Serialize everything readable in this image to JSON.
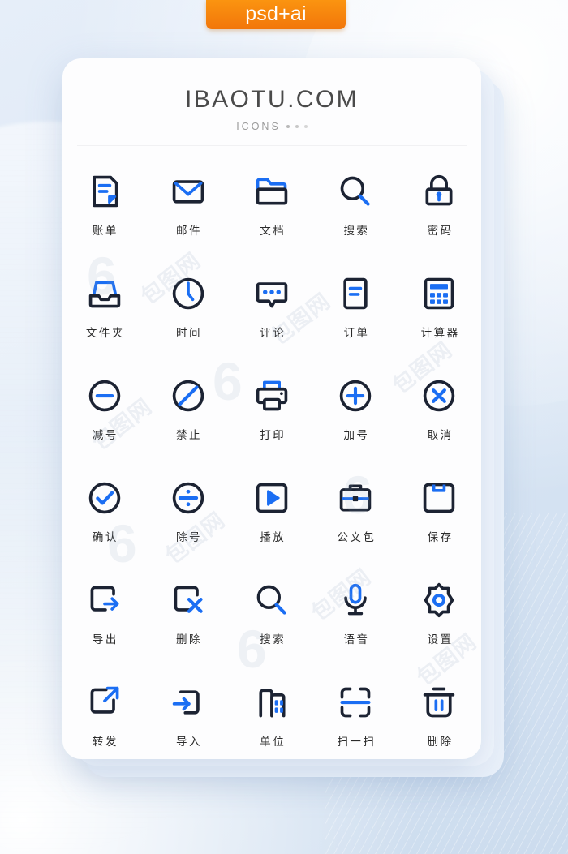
{
  "tag": {
    "label": "psd+ai",
    "color": "#f5820b"
  },
  "header": {
    "brand": "IBAOTU.COM",
    "subtitle": "ICONS"
  },
  "palette": {
    "icon_dark": "#1c2333",
    "icon_blue": "#1b6ef3",
    "background": "#dbe7f5",
    "card": "#fdfdfe",
    "caption": "#2b2b2b"
  },
  "watermark": {
    "text": "包图网",
    "mark": "6"
  },
  "grid": {
    "columns": 5,
    "rows": 6,
    "icons": [
      {
        "label": "账单",
        "name": "bill-icon"
      },
      {
        "label": "邮件",
        "name": "mail-icon"
      },
      {
        "label": "文档",
        "name": "document-folder-icon"
      },
      {
        "label": "搜索",
        "name": "search-icon"
      },
      {
        "label": "密码",
        "name": "lock-icon"
      },
      {
        "label": "文件夹",
        "name": "file-tray-icon"
      },
      {
        "label": "时间",
        "name": "clock-icon"
      },
      {
        "label": "评论",
        "name": "comment-icon"
      },
      {
        "label": "订单",
        "name": "order-icon"
      },
      {
        "label": "计算器",
        "name": "calculator-icon"
      },
      {
        "label": "减号",
        "name": "minus-circle-icon"
      },
      {
        "label": "禁止",
        "name": "forbidden-icon"
      },
      {
        "label": "打印",
        "name": "printer-icon"
      },
      {
        "label": "加号",
        "name": "plus-circle-icon"
      },
      {
        "label": "取消",
        "name": "cancel-circle-icon"
      },
      {
        "label": "确认",
        "name": "check-circle-icon"
      },
      {
        "label": "除号",
        "name": "divide-circle-icon"
      },
      {
        "label": "播放",
        "name": "play-icon"
      },
      {
        "label": "公文包",
        "name": "briefcase-icon"
      },
      {
        "label": "保存",
        "name": "save-box-icon"
      },
      {
        "label": "导出",
        "name": "export-icon"
      },
      {
        "label": "删除",
        "name": "delete-x-icon"
      },
      {
        "label": "搜索",
        "name": "search-magnifier-icon"
      },
      {
        "label": "语音",
        "name": "microphone-icon"
      },
      {
        "label": "设置",
        "name": "settings-gear-icon"
      },
      {
        "label": "转发",
        "name": "forward-share-icon"
      },
      {
        "label": "导入",
        "name": "import-icon"
      },
      {
        "label": "单位",
        "name": "company-building-icon"
      },
      {
        "label": "扫一扫",
        "name": "scan-icon"
      },
      {
        "label": "删除",
        "name": "trash-icon"
      }
    ]
  }
}
